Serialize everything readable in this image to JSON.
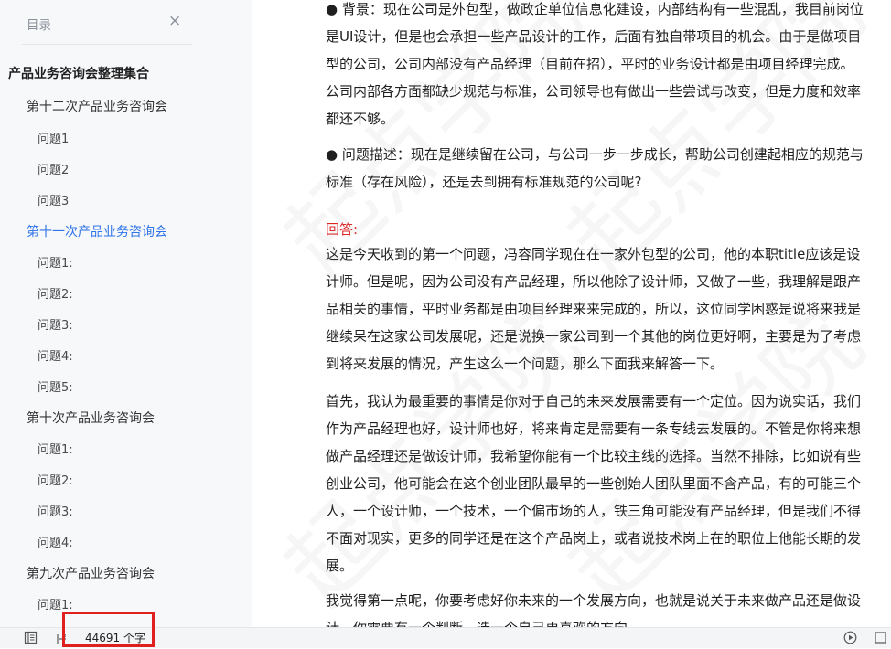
{
  "sidebar": {
    "header": "目录",
    "close_glyph": "×",
    "items": [
      {
        "label": "产品业务咨询会整理集合",
        "level": 0
      },
      {
        "label": "第十二次产品业务咨询会",
        "level": 1
      },
      {
        "label": "问题1",
        "level": 2
      },
      {
        "label": "问题2",
        "level": 2
      },
      {
        "label": "问题3",
        "level": 2
      },
      {
        "label": "第十一次产品业务咨询会",
        "level": 1,
        "active": true
      },
      {
        "label": "问题1:",
        "level": 2
      },
      {
        "label": "问题2:",
        "level": 2
      },
      {
        "label": "问题3:",
        "level": 2
      },
      {
        "label": "问题4:",
        "level": 2
      },
      {
        "label": "问题5:",
        "level": 2
      },
      {
        "label": "第十次产品业务咨询会",
        "level": 1
      },
      {
        "label": "问题1:",
        "level": 2
      },
      {
        "label": "问题2:",
        "level": 2
      },
      {
        "label": "问题3:",
        "level": 2
      },
      {
        "label": "问题4:",
        "level": 2
      },
      {
        "label": "第九次产品业务咨询会",
        "level": 1
      },
      {
        "label": "问题1:",
        "level": 2
      }
    ]
  },
  "content": {
    "paragraphs": [
      {
        "lines": [
          "● 背景：现在公司是外包型，做政企单位信息化建设，内部结构有一些混乱，我目前岗位",
          "是UI设计，但是也会承担一些产品设计的工作，后面有独自带项目的机会。由于是做项目",
          "型的公司，公司内部没有产品经理（目前在招），平时的业务设计都是由项目经理完成。",
          "公司内部各方面都缺少规范与标准，公司领导也有做出一些尝试与改变，但是力度和效率",
          "都还不够。"
        ]
      },
      {
        "lines": [
          "● 问题描述：现在是继续留在公司，与公司一步一步成长，帮助公司创建起相应的规范与",
          "标准（存在风险），还是去到拥有标准规范的公司呢?"
        ]
      },
      {
        "lines": [
          "回答:"
        ],
        "red": true
      },
      {
        "lines": [
          "这是今天收到的第一个问题，冯容同学现在在一家外包型的公司，他的本职title应该是设",
          "计师。但是呢，因为公司没有产品经理，所以他除了设计师，又做了一些，我理解是跟产",
          "品相关的事情，平时业务都是由项目经理来来完成的，所以，这位同学困惑是说将来我是",
          "继续呆在这家公司发展呢，还是说换一家公司到一个其他的岗位更好啊，主要是为了考虑",
          "到将来发展的情况，产生这么一个问题，那么下面我来解答一下。"
        ]
      },
      {
        "lines": [
          "首先，我认为最重要的事情是你对于自己的未来发展需要有一个定位。因为说实话，我们",
          "作为产品经理也好，设计师也好，将来肯定是需要有一条专线去发展的。不管是你将来想",
          "做产品经理还是做设计师，我希望你能有一个比较主线的选择。当然不排除，比如说有些",
          "创业公司，他可能会在这个创业团队最早的一些创始人团队里面不含产品，有的可能三个",
          "人，一个设计师，一个技术，一个偏市场的人，铁三角可能没有产品经理，但是我们不得",
          "不面对现实，更多的同学还是在这个产品岗上，或者说技术岗上在的职位上他能长期的发",
          "展。"
        ]
      },
      {
        "lines": [
          "我觉得第一点呢，你要考虑好你未来的一个发展方向，也就是说关于未来做产品还是做设",
          "计，你需要有一个判断，选一个自己更喜欢的方向"
        ]
      }
    ],
    "watermark_text": "起点学院"
  },
  "statusbar": {
    "word_count": "44691 个字",
    "icons": [
      "outline-toggle-icon",
      "layout-icon",
      "play-icon"
    ]
  },
  "colors": {
    "active_link": "#2f74e8",
    "answer_label": "#e02424",
    "highlight_box": "#e0201e"
  }
}
